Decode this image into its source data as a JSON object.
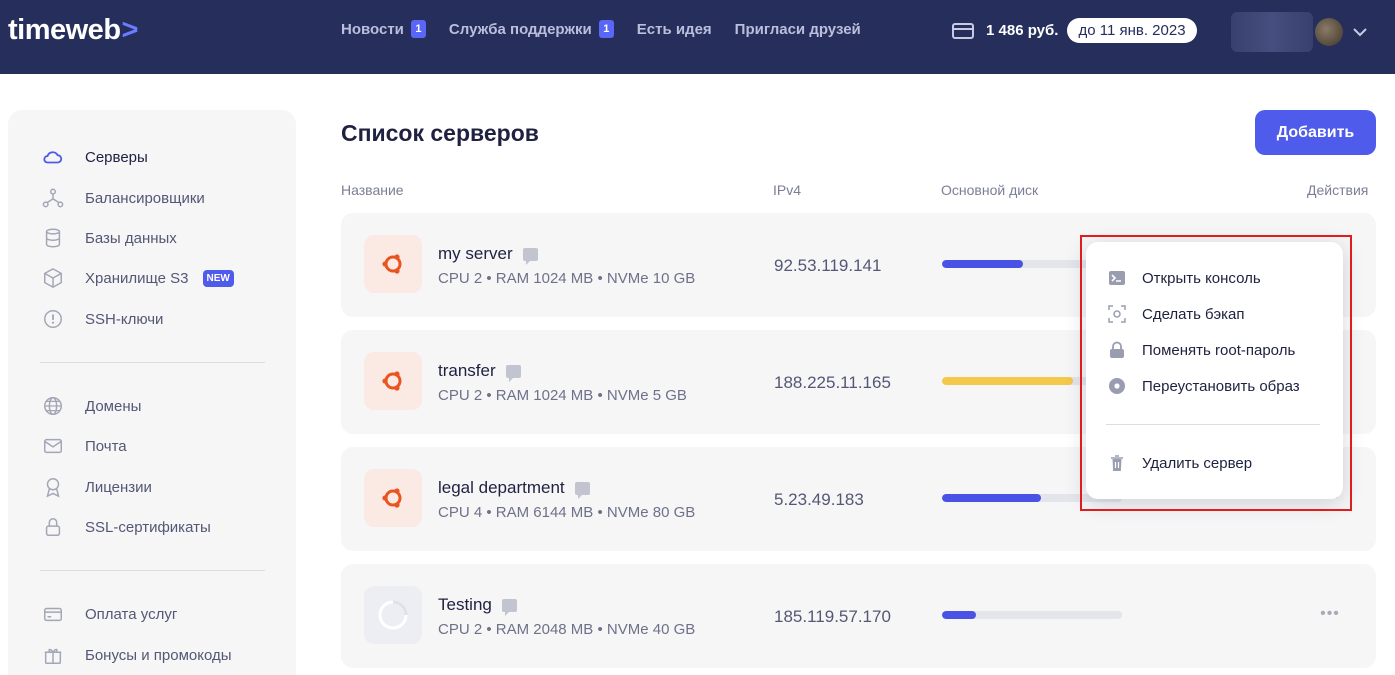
{
  "header": {
    "logo": "timeweb",
    "logo_chevron": ">",
    "nav": [
      {
        "label": "Новости",
        "badge": "1"
      },
      {
        "label": "Служба поддержки",
        "badge": "1"
      },
      {
        "label": "Есть идея"
      },
      {
        "label": "Пригласи друзей"
      }
    ],
    "balance_amount": "1 486 руб.",
    "balance_until": "до 11 янв. 2023",
    "icons": {
      "card": "credit-card-icon",
      "chevron": "chevron-down-icon"
    }
  },
  "sidebar": {
    "items": [
      {
        "label": "Серверы",
        "icon": "cloud-icon",
        "active": true
      },
      {
        "label": "Балансировщики",
        "icon": "balancer-icon"
      },
      {
        "label": "Базы данных",
        "icon": "database-icon"
      },
      {
        "label": "Хранилище S3",
        "icon": "cube-icon",
        "badge": "NEW"
      },
      {
        "label": "SSH-ключи",
        "icon": "key-icon"
      },
      {
        "label": "Домены",
        "icon": "globe-icon"
      },
      {
        "label": "Почта",
        "icon": "mail-icon"
      },
      {
        "label": "Лицензии",
        "icon": "license-icon"
      },
      {
        "label": "SSL-сертификаты",
        "icon": "lock-icon"
      },
      {
        "label": "Оплата услуг",
        "icon": "wallet-icon"
      },
      {
        "label": "Бонусы и промокоды",
        "icon": "gift-icon"
      }
    ]
  },
  "main": {
    "title": "Список серверов",
    "add_button": "Добавить",
    "columns": {
      "name": "Название",
      "ip": "IPv4",
      "disk": "Основной диск",
      "actions": "Действия"
    },
    "servers": [
      {
        "name": "my server",
        "spec": "CPU 2 • RAM 1024 MB • NVMe 10 GB",
        "ip": "92.53.119.141",
        "disk_fraction": 0.45,
        "disk_color": "#4a52e6",
        "os": "ubuntu"
      },
      {
        "name": "transfer",
        "spec": "CPU 2 • RAM 1024 MB • NVMe 5 GB",
        "ip": "188.225.11.165",
        "disk_fraction": 0.73,
        "disk_color": "#f4c84a",
        "os": "ubuntu"
      },
      {
        "name": "legal department",
        "spec": "CPU 4 • RAM 6144 MB • NVMe 80 GB",
        "ip": "5.23.49.183",
        "disk_fraction": 0.55,
        "disk_color": "#4a52e6",
        "os": "ubuntu"
      },
      {
        "name": "Testing",
        "spec": "CPU 2 • RAM 2048 MB • NVMe 40 GB",
        "ip": "185.119.57.170",
        "disk_fraction": 0.19,
        "disk_color": "#4a52e6",
        "os": "loading"
      }
    ],
    "more_label": "•••"
  },
  "context_menu": {
    "items": [
      {
        "label": "Открыть консоль",
        "icon": "terminal-icon"
      },
      {
        "label": "Сделать бэкап",
        "icon": "backup-icon"
      },
      {
        "label": "Поменять root-пароль",
        "icon": "lock-icon"
      },
      {
        "label": "Переустановить образ",
        "icon": "disc-icon"
      }
    ],
    "danger_item": {
      "label": "Удалить сервер",
      "icon": "trash-icon"
    }
  }
}
